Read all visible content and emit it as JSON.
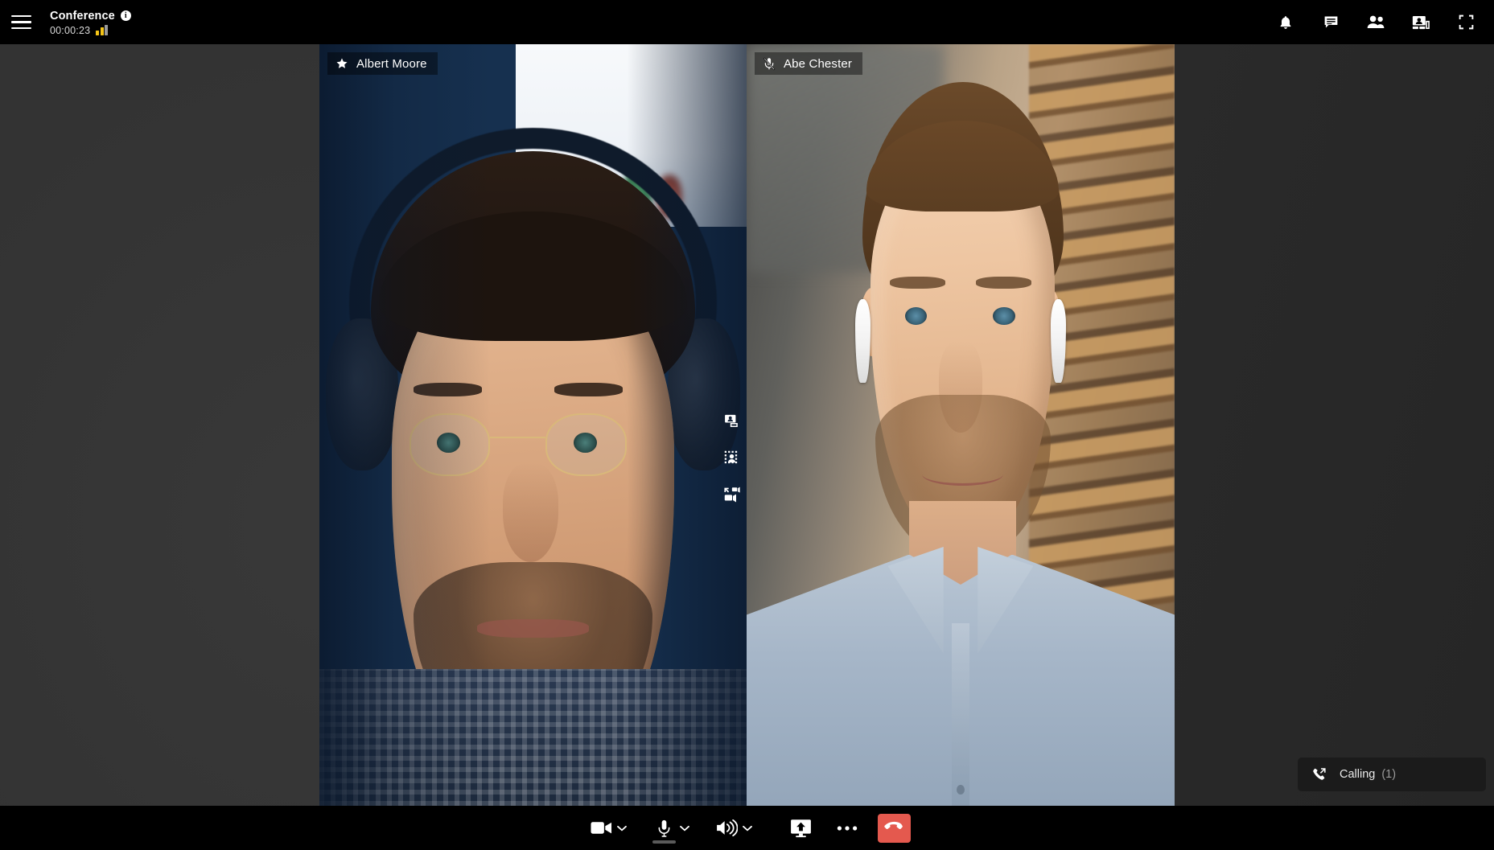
{
  "header": {
    "menu_icon": "hamburger-menu-icon",
    "title": "Conference",
    "info_icon": "info-icon",
    "timer": "00:00:23",
    "signal_icon": "signal-strength-icon",
    "signal_bars_active": 2,
    "signal_bars_total": 3,
    "signal_color": "#f5c518",
    "actions": [
      {
        "name": "notifications-button",
        "icon": "bell-icon",
        "label": "Notifications"
      },
      {
        "name": "chat-button",
        "icon": "chat-bubble-icon",
        "label": "Chat"
      },
      {
        "name": "participants-button",
        "icon": "people-icon",
        "label": "Participants"
      },
      {
        "name": "layout-button",
        "icon": "gallery-layout-icon",
        "label": "Layout"
      },
      {
        "name": "fullscreen-button",
        "icon": "fullscreen-icon",
        "label": "Fullscreen"
      }
    ]
  },
  "stage": {
    "background_color": "#2f2f2f",
    "participants": [
      {
        "name": "Albert Moore",
        "status_icon": "star-icon",
        "status": "pinned",
        "tile_actions": [
          {
            "name": "picture-in-picture-icon",
            "label": "Picture in picture"
          },
          {
            "name": "blur-background-icon",
            "label": "Blur background"
          },
          {
            "name": "expand-video-icon",
            "label": "Expand video"
          }
        ]
      },
      {
        "name": "Abe Chester",
        "status_icon": "microphone-muted-icon",
        "status": "muted",
        "tile_actions": []
      }
    ]
  },
  "toast": {
    "icon": "outgoing-call-icon",
    "label": "Calling",
    "count": "(1)"
  },
  "toolbar": {
    "background_color": "#000000",
    "controls": [
      {
        "name": "camera-button",
        "icon": "video-camera-icon",
        "label": "Camera",
        "has_chevron": true
      },
      {
        "name": "microphone-button",
        "icon": "microphone-icon",
        "label": "Microphone",
        "has_chevron": true,
        "has_level_meter": true
      },
      {
        "name": "speaker-button",
        "icon": "speaker-icon",
        "label": "Speaker",
        "has_chevron": true
      },
      {
        "name": "share-screen-button",
        "icon": "screen-share-icon",
        "label": "Share screen",
        "has_chevron": false
      },
      {
        "name": "more-options-button",
        "icon": "more-horizontal-icon",
        "label": "More options",
        "has_chevron": false
      }
    ],
    "hangup": {
      "name": "hangup-button",
      "icon": "phone-hangup-icon",
      "label": "Leave call",
      "color": "#e4594e"
    }
  }
}
